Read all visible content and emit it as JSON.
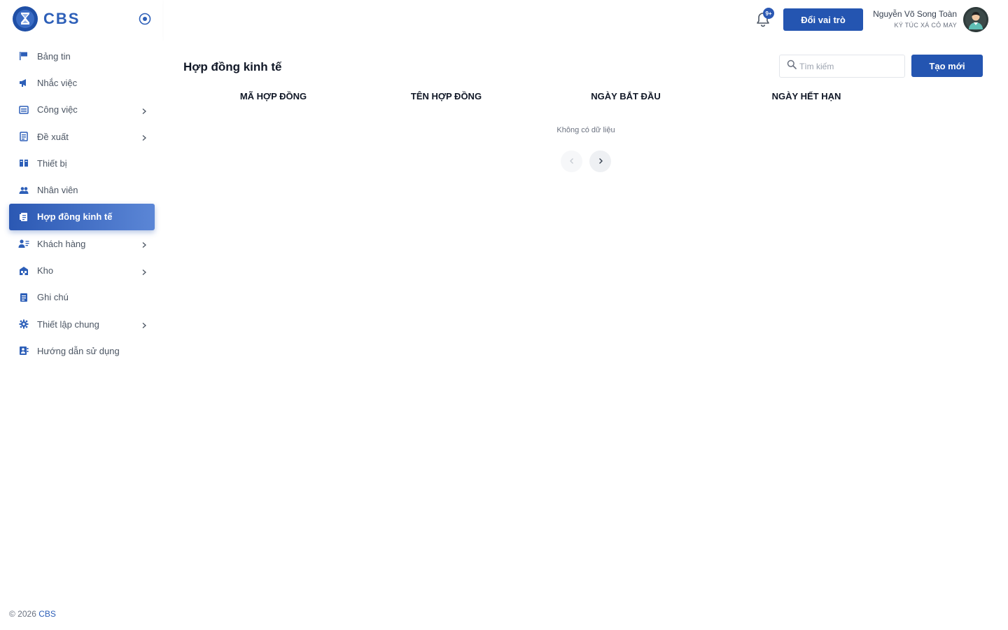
{
  "brand": {
    "name": "CBS"
  },
  "sidebar": {
    "items": [
      {
        "label": "Bảng tin",
        "icon": "flag-icon",
        "has_submenu": false,
        "active": false
      },
      {
        "label": "Nhắc việc",
        "icon": "megaphone-icon",
        "has_submenu": false,
        "active": false
      },
      {
        "label": "Công việc",
        "icon": "task-icon",
        "has_submenu": true,
        "active": false
      },
      {
        "label": "Đề xuất",
        "icon": "proposal-icon",
        "has_submenu": true,
        "active": false
      },
      {
        "label": "Thiết bị",
        "icon": "device-icon",
        "has_submenu": false,
        "active": false
      },
      {
        "label": "Nhân viên",
        "icon": "people-icon",
        "has_submenu": false,
        "active": false
      },
      {
        "label": "Hợp đồng kinh tế",
        "icon": "contract-icon",
        "has_submenu": false,
        "active": true
      },
      {
        "label": "Khách hàng",
        "icon": "customer-icon",
        "has_submenu": true,
        "active": false
      },
      {
        "label": "Kho",
        "icon": "warehouse-icon",
        "has_submenu": true,
        "active": false
      },
      {
        "label": "Ghi chú",
        "icon": "note-icon",
        "has_submenu": false,
        "active": false
      },
      {
        "label": "Thiết lập chung",
        "icon": "gear-icon",
        "has_submenu": true,
        "active": false
      },
      {
        "label": "Hướng dẫn sử dụng",
        "icon": "guide-icon",
        "has_submenu": false,
        "active": false
      }
    ],
    "footer": {
      "copyright": "© 2026",
      "brand": "CBS"
    }
  },
  "header": {
    "notification_badge": "9+",
    "switch_role_label": "Đổi vai trò",
    "user_name": "Nguyễn Võ Song Toàn",
    "user_org": "KÝ TÚC XÁ CỎ MAY"
  },
  "main": {
    "title": "Hợp đồng kinh tế",
    "search_placeholder": "Tìm kiếm",
    "create_label": "Tạo mới",
    "columns": [
      "MÃ HỢP ĐỒNG",
      "TÊN HỢP ĐỒNG",
      "NGÀY BẮT ĐẦU",
      "NGÀY HẾT HẠN"
    ],
    "empty_text": "Không có dữ liệu"
  },
  "colors": {
    "accent": "#2455b1",
    "brand": "#2d5fb8",
    "active_gradient_start": "#2b58b3",
    "active_gradient_end": "#5b86d6"
  }
}
